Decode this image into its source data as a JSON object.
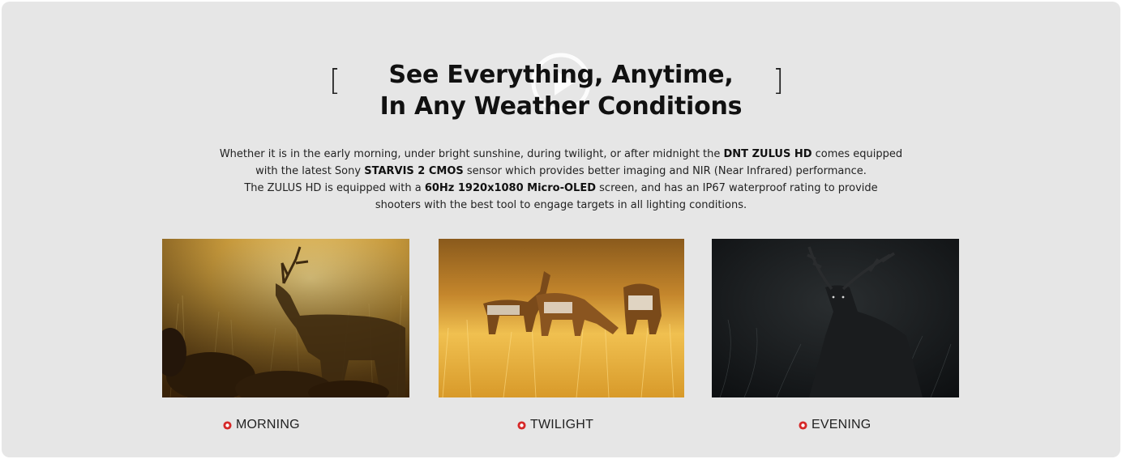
{
  "heading": {
    "line1": "See Everything, Anytime,",
    "line2": "In Any Weather Conditions",
    "bracket_left": "[",
    "bracket_right": "]"
  },
  "description": {
    "l1_a": "Whether it is in the early morning, under bright sunshine, during twilight, or after midnight the ",
    "l1_b": "DNT ZULUS HD",
    "l1_c": " comes equipped",
    "l2_a": "with the latest Sony ",
    "l2_b": "STARVIS 2 CMOS",
    "l2_c": " sensor which provides better imaging and NIR (Near Infrared) performance.",
    "l3_a": "The ZULUS HD is equipped with a ",
    "l3_b": "60Hz 1920x1080 Micro-OLED",
    "l3_c": " screen, and has an IP67 waterproof rating to provide",
    "l4": "shooters with the best tool to engage targets in all lighting conditions."
  },
  "gallery": [
    {
      "label": "MORNING",
      "icon": "circle-plus-icon"
    },
    {
      "label": "TWILIGHT",
      "icon": "circle-plus-icon"
    },
    {
      "label": "EVENING",
      "icon": "circle-plus-icon"
    }
  ],
  "colors": {
    "panel_bg": "#e6e6e6",
    "accent_red": "#d62828"
  }
}
